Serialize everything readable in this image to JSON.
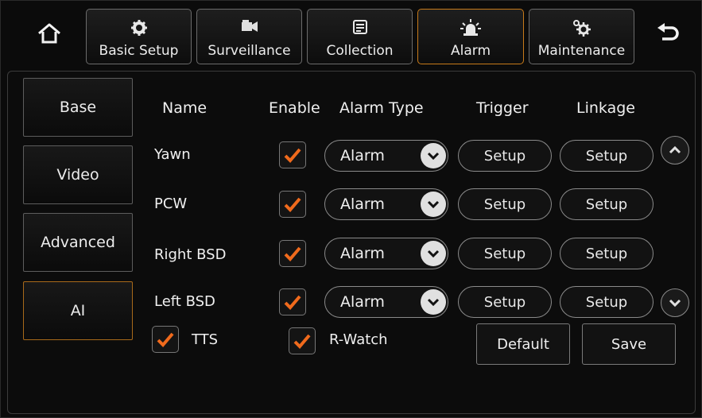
{
  "nav": {
    "tabs": [
      {
        "label": "Basic Setup",
        "icon": "gear-icon"
      },
      {
        "label": "Surveillance",
        "icon": "camera-icon"
      },
      {
        "label": "Collection",
        "icon": "collection-icon"
      },
      {
        "label": "Alarm",
        "icon": "siren-icon"
      },
      {
        "label": "Maintenance",
        "icon": "gears-icon"
      }
    ],
    "active_tab": "Alarm",
    "home_icon": "home-icon",
    "back_icon": "back-icon"
  },
  "sidebar": {
    "items": [
      {
        "label": "Base"
      },
      {
        "label": "Video"
      },
      {
        "label": "Advanced"
      },
      {
        "label": "AI"
      }
    ],
    "active": "AI"
  },
  "table": {
    "headers": {
      "name": "Name",
      "enable": "Enable",
      "alarm_type": "Alarm Type",
      "trigger": "Trigger",
      "linkage": "Linkage"
    },
    "rows": [
      {
        "name": "Yawn",
        "enabled": true,
        "alarm_type": "Alarm",
        "trigger": "Setup",
        "linkage": "Setup"
      },
      {
        "name": "PCW",
        "enabled": true,
        "alarm_type": "Alarm",
        "trigger": "Setup",
        "linkage": "Setup"
      },
      {
        "name": "Right BSD",
        "enabled": true,
        "alarm_type": "Alarm",
        "trigger": "Setup",
        "linkage": "Setup"
      },
      {
        "name": "Left BSD",
        "enabled": true,
        "alarm_type": "Alarm",
        "trigger": "Setup",
        "linkage": "Setup"
      }
    ]
  },
  "options": {
    "tts": {
      "label": "TTS",
      "checked": true
    },
    "rwatch": {
      "label": "R-Watch",
      "checked": true
    }
  },
  "actions": {
    "default_label": "Default",
    "save_label": "Save"
  },
  "colors": {
    "accent": "#c77a1a",
    "check": "#f06a1c",
    "background": "#0b0b0b"
  }
}
